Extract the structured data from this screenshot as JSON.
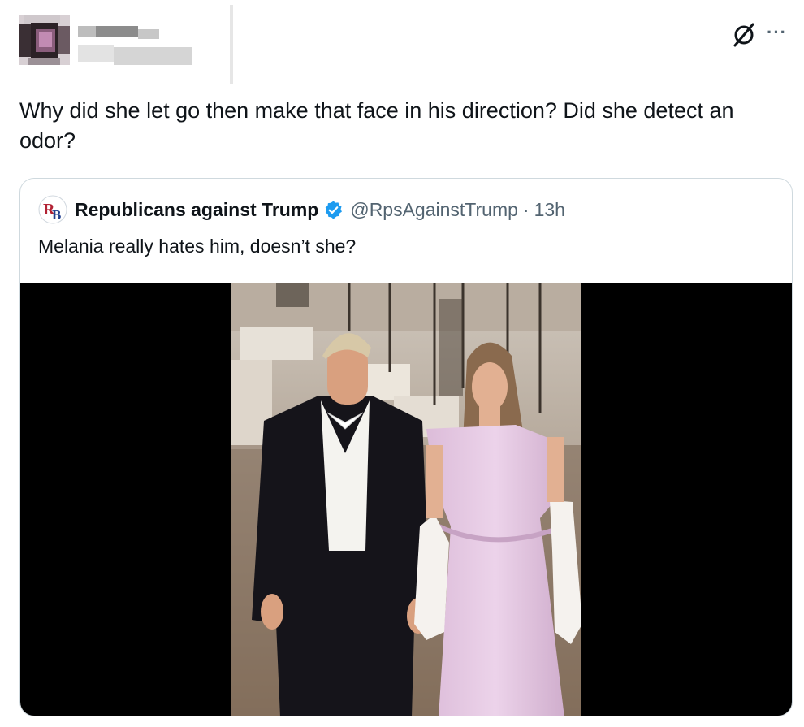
{
  "post": {
    "text": "Why did she let go then make that face in his direction? Did she detect an odor?",
    "more_icon": "···"
  },
  "quoted_post": {
    "logo_text": "RB",
    "display_name": "Republicans against Trump",
    "handle": "@RpsAgainstTrump",
    "separator": "·",
    "time": "13h",
    "text": "Melania really hates him, doesn’t she?"
  },
  "colors": {
    "text_primary": "#0f1419",
    "text_secondary": "#536471",
    "verified_blue": "#1d9bf0",
    "card_border": "#cfd9de",
    "dress": "#e5c8e3"
  }
}
